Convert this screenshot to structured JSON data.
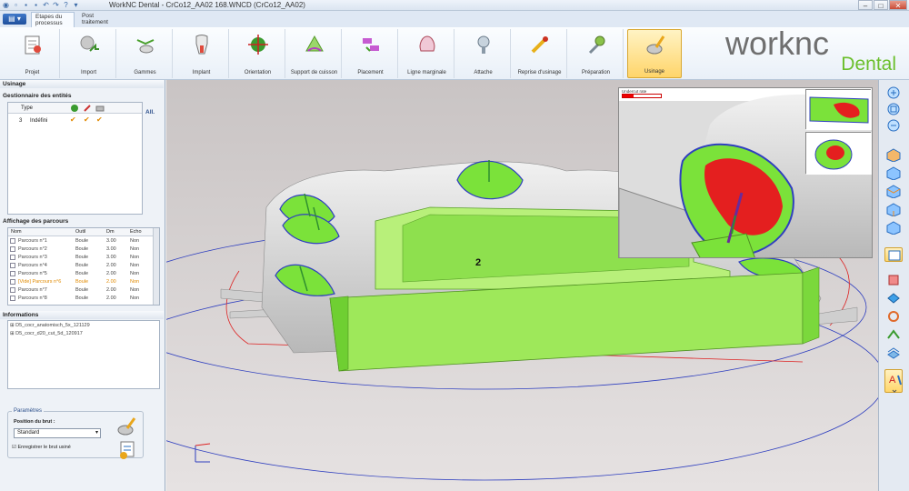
{
  "window": {
    "title": "WorkNC Dental  - CrCo12_AA02 168.WNCD (CrCo12_AA02)"
  },
  "tabs": [
    {
      "label": "Etapes du\nprocessus"
    },
    {
      "label": "Post\ntraitement"
    }
  ],
  "ribbon": {
    "groups": [
      {
        "label": "Projet",
        "icon": "project-icon"
      },
      {
        "label": "Import",
        "icon": "import-icon"
      },
      {
        "label": "Gammes",
        "icon": "gammes-icon"
      },
      {
        "label": "Implant",
        "icon": "implant-icon"
      },
      {
        "label": "Orientation",
        "icon": "orientation-icon"
      },
      {
        "label": "Support de cuisson",
        "icon": "firing-support-icon"
      },
      {
        "label": "Placement",
        "icon": "placement-icon"
      },
      {
        "label": "Ligne marginale",
        "icon": "margin-line-icon"
      },
      {
        "label": "Attache",
        "icon": "attachment-icon"
      },
      {
        "label": "Reprise d'usinage",
        "icon": "rework-icon"
      },
      {
        "label": "Préparation",
        "icon": "preparation-icon"
      },
      {
        "label": "Usinage",
        "icon": "machining-icon"
      }
    ],
    "active": "Usinage"
  },
  "logo": {
    "word": "worknc",
    "sub": "Dental",
    "brand_green": "#6bbf2c",
    "brand_gray": "#6f6f6f"
  },
  "panel": {
    "title": "Usinage",
    "entity_manager": {
      "title": "Gestionnaire des entités",
      "col_type": "Type",
      "all_label": "All.",
      "rows": [
        {
          "num": "3",
          "type": "Indéfini"
        }
      ]
    },
    "toolpaths": {
      "title": "Affichage des parcours",
      "columns": [
        "Nom",
        "Outil",
        "Dm",
        "Echo"
      ],
      "rows": [
        {
          "name": "Parcours n°1",
          "tool": "Boule",
          "dm": "3.00",
          "echo": "Non",
          "hl": false
        },
        {
          "name": "Parcours n°2",
          "tool": "Boule",
          "dm": "3.00",
          "echo": "Non",
          "hl": false
        },
        {
          "name": "Parcours n°3",
          "tool": "Boule",
          "dm": "3.00",
          "echo": "Non",
          "hl": false
        },
        {
          "name": "Parcours n°4",
          "tool": "Boule",
          "dm": "2.00",
          "echo": "Non",
          "hl": false
        },
        {
          "name": "Parcours n°5",
          "tool": "Boule",
          "dm": "2.00",
          "echo": "Non",
          "hl": false
        },
        {
          "name": "[Vide] Parcours n°6",
          "tool": "Boule",
          "dm": "2.00",
          "echo": "Non",
          "hl": true
        },
        {
          "name": "Parcours n°7",
          "tool": "Boule",
          "dm": "2.00",
          "echo": "Non",
          "hl": false
        },
        {
          "name": "Parcours n°8",
          "tool": "Boule",
          "dm": "2.00",
          "echo": "Non",
          "hl": false
        }
      ]
    },
    "information": {
      "title": "Informations",
      "items": [
        "D5_cocr_anatomisch_5x_121129",
        "D5_cocr_d20_cut_5d_120917"
      ]
    },
    "params": {
      "title": "Paramètres",
      "position_label": "Position du brut :",
      "position_value": "Standard",
      "save_label": "Enregistrer le brut usiné"
    }
  },
  "viewport": {
    "part_label": "2",
    "inset_label": "Undercut rate"
  },
  "colors": {
    "part_green": "#7be23a",
    "undercut_red": "#e41f1f",
    "rim_blue": "#2f3fbf"
  }
}
